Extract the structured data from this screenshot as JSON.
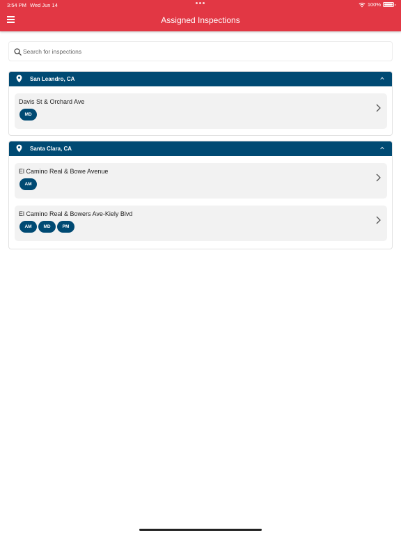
{
  "status_bar": {
    "time": "3:54 PM",
    "date": "Wed Jun 14",
    "battery": "100%"
  },
  "header": {
    "title": "Assigned Inspections"
  },
  "search": {
    "placeholder": "Search for inspections",
    "value": ""
  },
  "colors": {
    "header_bg": "#e23744",
    "section_bg": "#004a73",
    "card_bg": "#f2f2f2",
    "badge_bg": "#004a73"
  },
  "icons": {
    "menu": "menu-icon",
    "search": "search-icon",
    "location": "pin-icon",
    "collapse": "chevron-up-icon",
    "open": "chevron-right-icon"
  },
  "sections": [
    {
      "title": "San Leandro, CA",
      "items": [
        {
          "title": "Davis St & Orchard Ave",
          "badges": [
            "MD"
          ]
        }
      ]
    },
    {
      "title": "Santa Clara, CA",
      "items": [
        {
          "title": "El Camino Real & Bowe Avenue",
          "badges": [
            "AM"
          ]
        },
        {
          "title": "El Camino Real & Bowers Ave-Kiely Blvd",
          "badges": [
            "AM",
            "MD",
            "PM"
          ]
        }
      ]
    }
  ]
}
